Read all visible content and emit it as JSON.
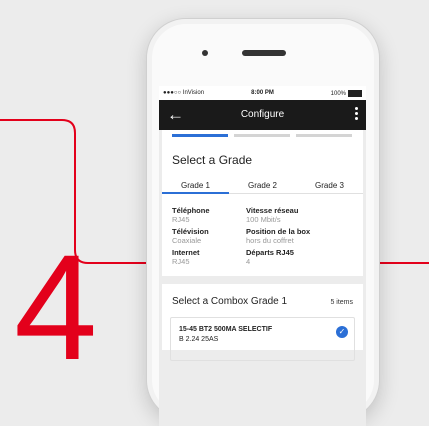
{
  "step_number": "4",
  "status_bar": {
    "carrier": "●●●○○ InVision",
    "time": "8:00 PM",
    "battery": "100%"
  },
  "app_bar": {
    "title": "Configure",
    "back_icon": "arrow-left-icon",
    "menu_icon": "more-vertical-icon"
  },
  "stepper": {
    "total_steps": 3,
    "current_step": 1
  },
  "grade_section": {
    "title": "Select a Grade",
    "tabs": [
      "Grade 1",
      "Grade 2",
      "Grade 3"
    ],
    "active_tab": 0,
    "specs": [
      {
        "label": "Téléphone",
        "value": "RJ45"
      },
      {
        "label": "Vitesse réseau",
        "value": "100 Mbit/s"
      },
      {
        "label": "Télévision",
        "value": "Coaxiale"
      },
      {
        "label": "Position de la box",
        "value": "hors du coffret"
      },
      {
        "label": "Internet",
        "value": "RJ45"
      },
      {
        "label": "Départs RJ45",
        "value": "4"
      }
    ]
  },
  "combo_section": {
    "title": "Select a Combox Grade 1",
    "count": "5 items",
    "items": [
      {
        "title": "15-45 BT2 500MA SELECTIF",
        "subtitle": "B 2.24 25AS",
        "selected": true
      }
    ]
  },
  "colors": {
    "accent": "#2b6fd6",
    "brand_red": "#e3001b",
    "app_bar": "#1a1a1a"
  }
}
